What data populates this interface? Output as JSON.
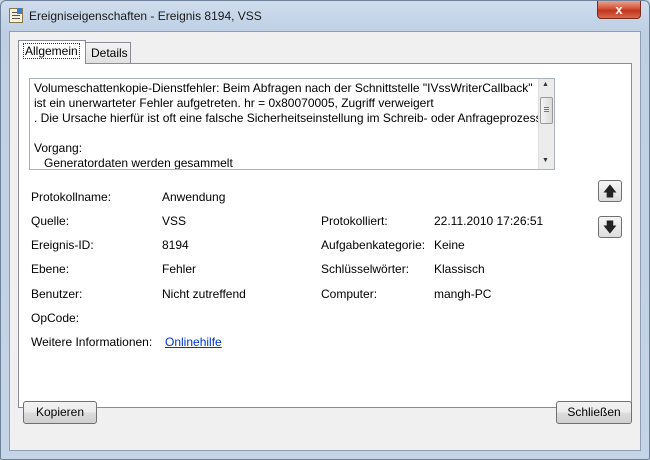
{
  "window": {
    "title": "Ereigniseigenschaften - Ereignis 8194, VSS",
    "close_glyph": "x"
  },
  "tabs": [
    {
      "label": "Allgemein",
      "active": true
    },
    {
      "label": "Details",
      "active": false
    }
  ],
  "description": {
    "lines": [
      "Volumeschattenkopie-Dienstfehler: Beim Abfragen nach der Schnittstelle \"IVssWriterCallback\"",
      "ist ein unerwarteter Fehler aufgetreten. hr = 0x80070005, Zugriff verweigert",
      ". Die Ursache hierfür ist oft eine falsche Sicherheitseinstellung im Schreib- oder Anfrageprozess.",
      "",
      "Vorgang:",
      "Generatordaten werden gesammelt"
    ]
  },
  "fields": {
    "protokollname": {
      "label": "Protokollname:",
      "value": "Anwendung"
    },
    "quelle": {
      "label": "Quelle:",
      "value": "VSS"
    },
    "protokolliert": {
      "label": "Protokolliert:",
      "value": "22.11.2010 17:26:51"
    },
    "ereignis_id": {
      "label": "Ereignis-ID:",
      "value": "8194"
    },
    "aufgabenkategorie": {
      "label": "Aufgabenkategorie:",
      "value": "Keine"
    },
    "ebene": {
      "label": "Ebene:",
      "value": "Fehler"
    },
    "schluesselwoerter": {
      "label": "Schlüsselwörter:",
      "value": "Klassisch"
    },
    "benutzer": {
      "label": "Benutzer:",
      "value": "Nicht zutreffend"
    },
    "computer": {
      "label": "Computer:",
      "value": "mangh-PC"
    },
    "opcode": {
      "label": "OpCode:",
      "value": ""
    },
    "weitere_informationen": {
      "label": "Weitere Informationen:",
      "value": "Onlinehilfe"
    }
  },
  "navigation": {
    "up_icon": "arrow-up-icon",
    "down_icon": "arrow-down-icon"
  },
  "buttons": {
    "copy": "Kopieren",
    "close": "Schließen"
  }
}
